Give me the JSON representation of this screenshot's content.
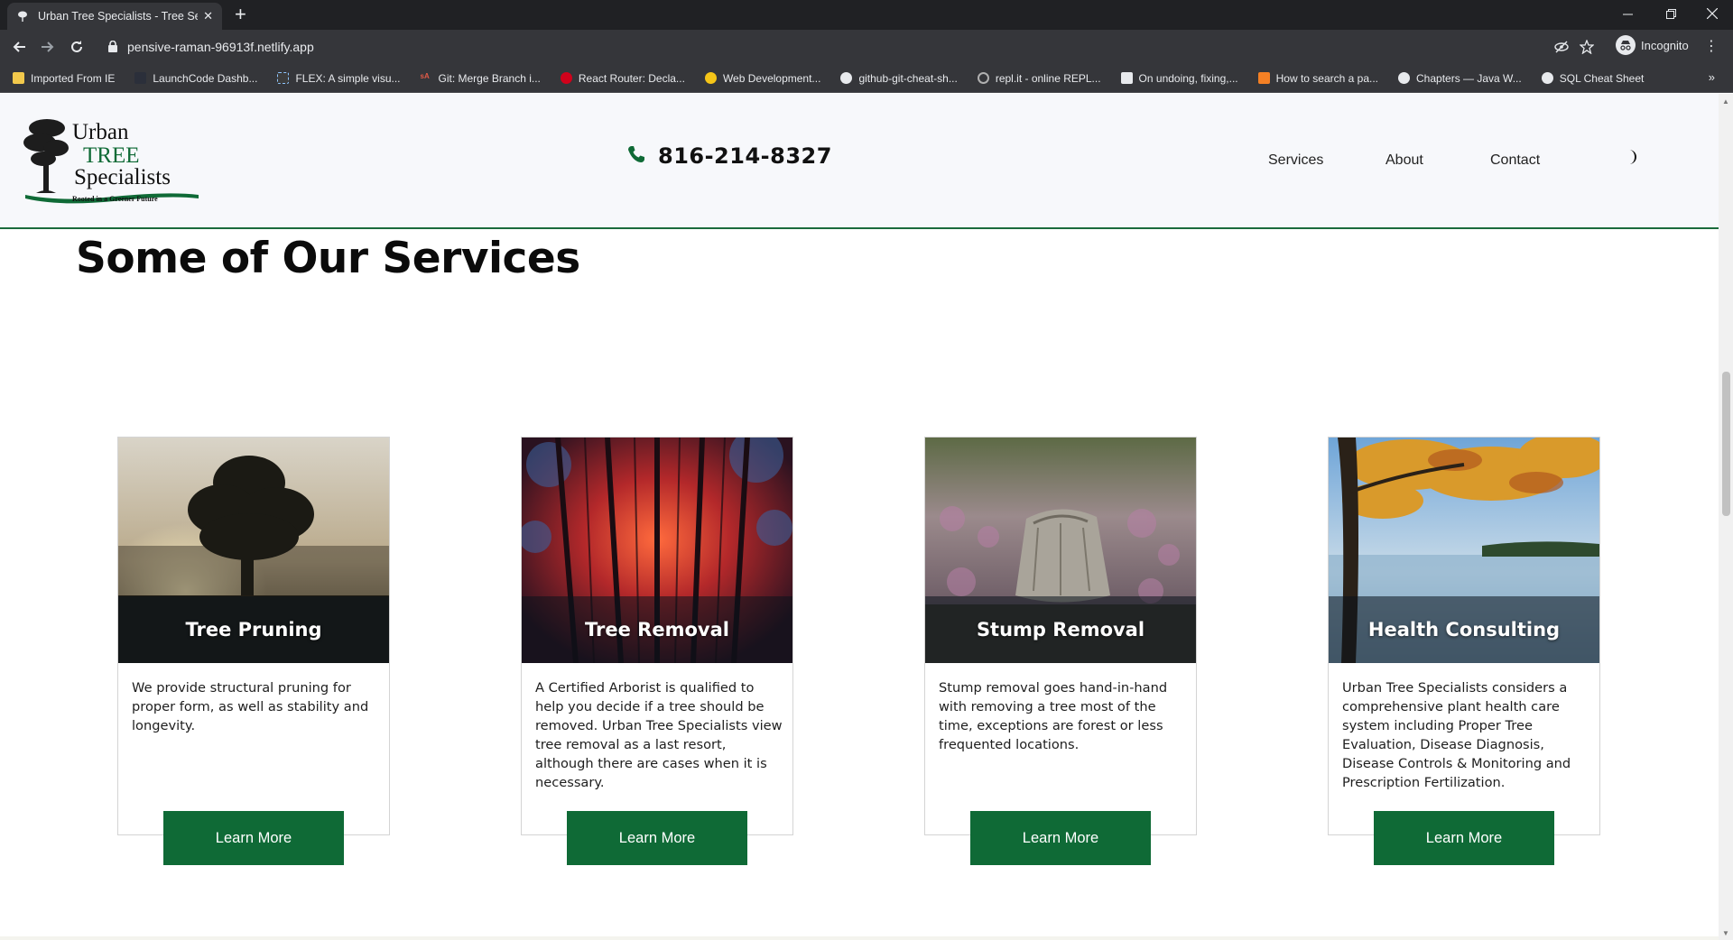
{
  "browser": {
    "tab_title": "Urban Tree Specialists - Tree Serv",
    "url": "pensive-raman-96913f.netlify.app",
    "profile_label": "Incognito",
    "bookmarks": [
      "Imported From IE",
      "LaunchCode Dashb...",
      "FLEX: A simple visu...",
      "Git: Merge Branch i...",
      "React Router: Decla...",
      "Web Development...",
      "github-git-cheat-sh...",
      "repl.it - online REPL...",
      "On undoing, fixing,...",
      "How to search a pa...",
      "Chapters — Java W...",
      "SQL Cheat Sheet"
    ],
    "bookmark_icons": [
      "folder-icon",
      "launchcode-icon",
      "flex-icon",
      "sa-icon",
      "react-router-icon",
      "b-icon",
      "github-icon",
      "replit-icon",
      "az-icon",
      "stack-icon",
      "chapters-icon",
      "sql-icon"
    ]
  },
  "site": {
    "logo": {
      "line1": "Urban",
      "line2": "TREE",
      "line3": "Specialists",
      "tagline": "Rooted in a Greener Future"
    },
    "phone": "816-214-8327",
    "nav": [
      "Services",
      "About",
      "Contact"
    ],
    "brand_color": "#0f6a36"
  },
  "services": {
    "title": "Some of Our Services",
    "cards": [
      {
        "title": "Tree Pruning",
        "text": "We provide structural pruning for proper form, as well as stability and longevity.",
        "button": "Learn More"
      },
      {
        "title": "Tree Removal",
        "text": "A Certified Arborist is qualified to help you decide if a tree should be removed. Urban Tree Specialists view tree removal as a last resort, although there are cases when it is necessary.",
        "button": "Learn More"
      },
      {
        "title": "Stump Removal",
        "text": "Stump removal goes hand-in-hand with removing a tree most of the time, exceptions are forest or less frequented locations.",
        "button": "Learn More"
      },
      {
        "title": "Health Consulting",
        "text": "Urban Tree Specialists considers a comprehensive plant health care system including Proper Tree Evaluation, Disease Diagnosis, Disease Controls & Monitoring and Prescription Fertilization.",
        "button": "Learn More"
      }
    ]
  }
}
